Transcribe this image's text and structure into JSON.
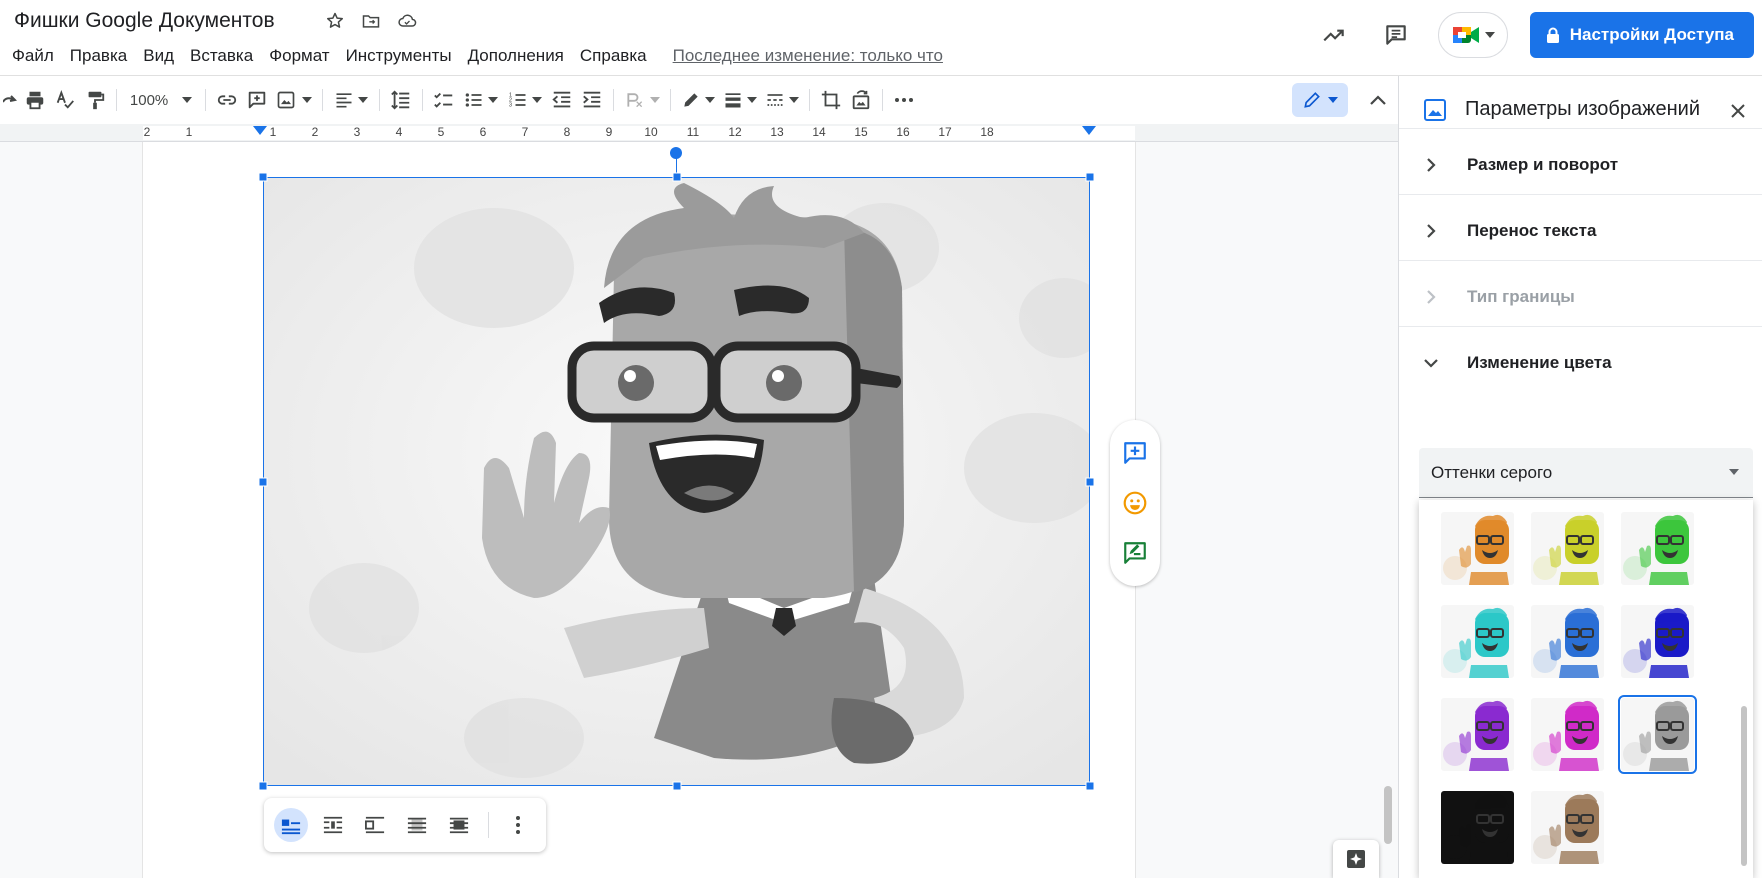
{
  "header": {
    "doc_title": "Фишки Google Документов",
    "menu": [
      "Файл",
      "Правка",
      "Вид",
      "Вставка",
      "Формат",
      "Инструменты",
      "Дополнения",
      "Справка"
    ],
    "last_edit": "Последнее изменение: только что",
    "share_label": "Настройки Доступа",
    "share_color": "#1a73e8"
  },
  "toolbar": {
    "zoom": "100%"
  },
  "ruler": {
    "numbers": [
      "2",
      "1",
      "1",
      "2",
      "3",
      "4",
      "5",
      "6",
      "7",
      "8",
      "9",
      "10",
      "11",
      "12",
      "13",
      "14",
      "15",
      "16",
      "17",
      "18"
    ]
  },
  "panel": {
    "title": "Параметры изображений",
    "sections": [
      {
        "label": "Размер и поворот",
        "expanded": false,
        "enabled": true
      },
      {
        "label": "Перенос текста",
        "expanded": false,
        "enabled": true
      },
      {
        "label": "Тип границы",
        "expanded": false,
        "enabled": false
      },
      {
        "label": "Изменение цвета",
        "expanded": true,
        "enabled": true
      }
    ],
    "recolor_value": "Оттенки серого",
    "swatches": [
      {
        "name": "orange",
        "color": "#e08a2a"
      },
      {
        "name": "yellow",
        "color": "#c9d02a"
      },
      {
        "name": "green",
        "color": "#3cc63c"
      },
      {
        "name": "cyan",
        "color": "#2cc8c8"
      },
      {
        "name": "blue",
        "color": "#2a6fd6"
      },
      {
        "name": "dark-blue",
        "color": "#1a1ac8"
      },
      {
        "name": "purple",
        "color": "#8a2ad0"
      },
      {
        "name": "magenta",
        "color": "#d02ac8"
      },
      {
        "name": "grayscale",
        "color": "#9a9a9a",
        "selected": true
      },
      {
        "name": "negative",
        "color": "#111111"
      },
      {
        "name": "sepia",
        "color": "#9c7a5a"
      }
    ]
  }
}
